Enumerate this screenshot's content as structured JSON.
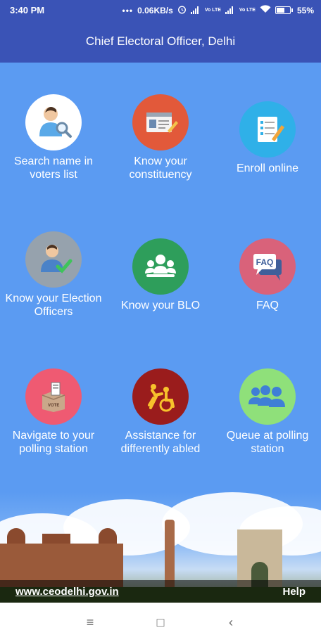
{
  "status_bar": {
    "time": "3:40 PM",
    "dots": "•••",
    "speed": "0.06KB/s",
    "volte_1": "Vo LTE",
    "volte_2": "Vo LTE",
    "battery_percent": "55%"
  },
  "app_bar": {
    "title": "Chief Electoral Officer, Delhi"
  },
  "tiles": [
    {
      "label": "Search name in voters list",
      "icon": "search-user-icon",
      "color": "#ffffff"
    },
    {
      "label": "Know your constituency",
      "icon": "id-card-icon",
      "color": "#e2593a"
    },
    {
      "label": "Enroll online",
      "icon": "form-pencil-icon",
      "color": "#2fb0e8"
    },
    {
      "label": "Know your Election Officers",
      "icon": "user-check-icon",
      "color": "#96a2ad"
    },
    {
      "label": "Know your BLO",
      "icon": "group-icon",
      "color": "#2e9e5b"
    },
    {
      "label": "FAQ",
      "icon": "faq-bubble-icon",
      "color": "#d9627a"
    },
    {
      "label": "Navigate to your polling station",
      "icon": "ballot-box-icon",
      "color": "#ef5a72"
    },
    {
      "label": "Assistance for differently abled",
      "icon": "wheelchair-icon",
      "color": "#9a1c1c"
    },
    {
      "label": "Queue at polling station",
      "icon": "queue-people-icon",
      "color": "#8fe07a"
    }
  ],
  "footer": {
    "website": "www.ceodelhi.gov.in",
    "help": "Help"
  },
  "nav": {
    "menu": "≡",
    "home": "□",
    "back": "‹"
  }
}
